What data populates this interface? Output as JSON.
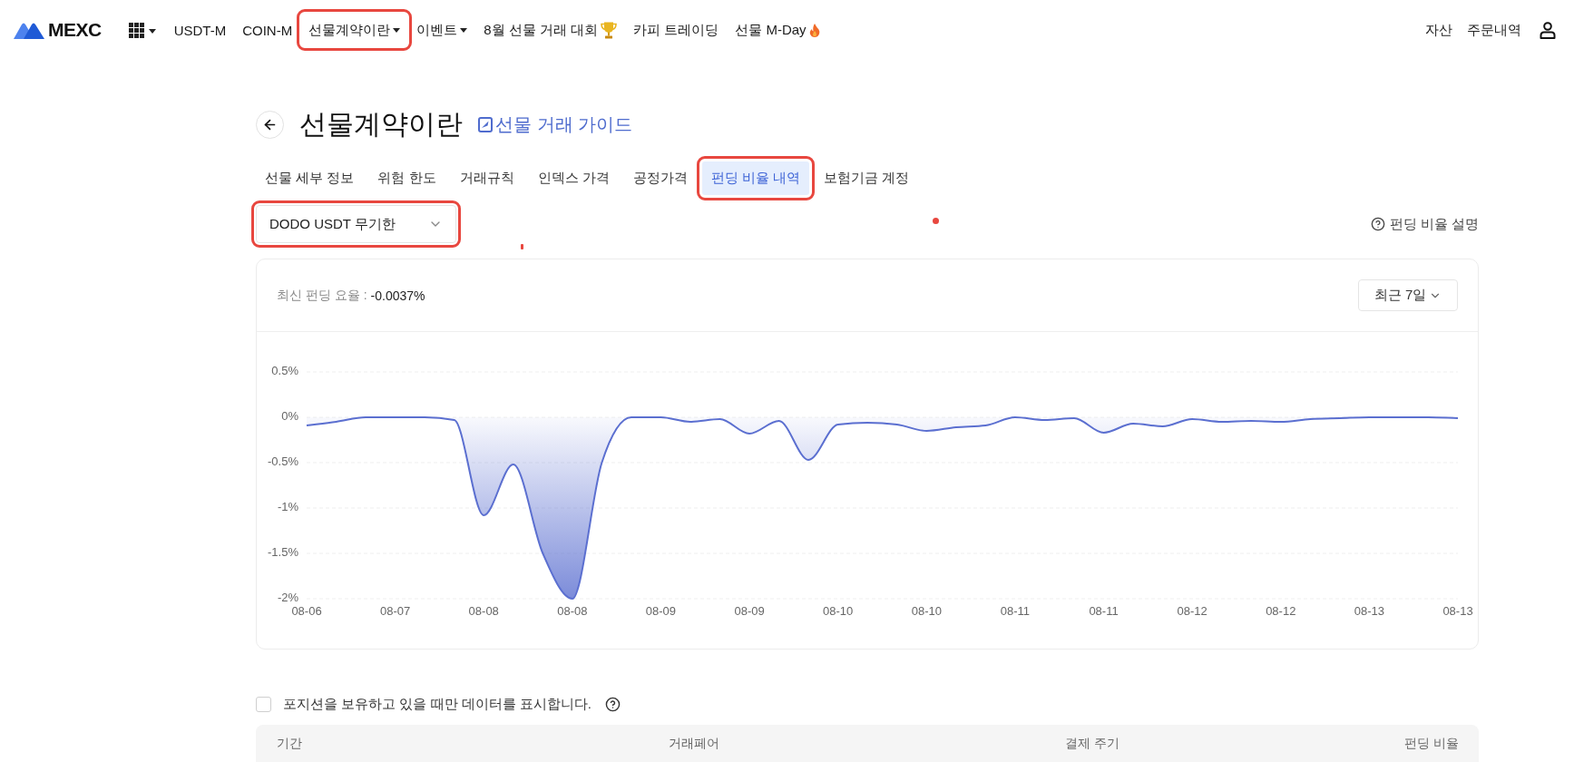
{
  "nav": {
    "logo": "MEXC",
    "items": [
      {
        "label": "USDT-M",
        "kind": "link",
        "highlighted": false
      },
      {
        "label": "COIN-M",
        "kind": "link",
        "highlighted": false
      },
      {
        "label": "선물계약이란",
        "kind": "dropdown",
        "highlighted": true
      },
      {
        "label": "이벤트",
        "kind": "dropdown",
        "highlighted": false
      },
      {
        "label": "8월 선물 거래 대회",
        "kind": "trophy",
        "highlighted": false
      },
      {
        "label": "카피 트레이딩",
        "kind": "link",
        "highlighted": false
      },
      {
        "label": "선물 M-Day",
        "kind": "fire",
        "highlighted": false
      }
    ],
    "right_items": [
      {
        "label": "자산"
      },
      {
        "label": "주문내역"
      }
    ]
  },
  "page": {
    "title": "선물계약이란",
    "guide_link": "선물 거래 가이드"
  },
  "tabs": [
    {
      "label": "선물 세부 정보",
      "selected": false,
      "highlighted": false
    },
    {
      "label": "위험 한도",
      "selected": false,
      "highlighted": false
    },
    {
      "label": "거래규칙",
      "selected": false,
      "highlighted": false
    },
    {
      "label": "인덱스 가격",
      "selected": false,
      "highlighted": false
    },
    {
      "label": "공정가격",
      "selected": false,
      "highlighted": false
    },
    {
      "label": "펀딩 비율 내역",
      "selected": true,
      "highlighted": true
    },
    {
      "label": "보험기금 계정",
      "selected": false,
      "highlighted": false
    }
  ],
  "contract_select": {
    "value": "DODO USDT 무기한",
    "highlighted": true
  },
  "help_link": "펀딩 비율 설명",
  "chart_card": {
    "latest_label": "최신 펀딩 요율 :",
    "latest_value": "-0.0037%",
    "period": "최근 7일",
    "chart_data": {
      "type": "area",
      "grid": true,
      "categories": [
        "08-06",
        null,
        null,
        "08-07",
        null,
        null,
        "08-08",
        null,
        null,
        "08-08",
        null,
        null,
        "08-09",
        null,
        null,
        "08-09",
        null,
        null,
        "08-10",
        null,
        null,
        "08-10",
        null,
        null,
        "08-11",
        null,
        null,
        "08-11",
        null,
        null,
        "08-12",
        null,
        null,
        "08-12",
        null,
        null,
        "08-13",
        null,
        null,
        "08-13"
      ],
      "series": [
        {
          "color": "#5b6fd0",
          "values": [
            -0.09,
            -0.05,
            0,
            0,
            0,
            -0.03,
            -1.08,
            -0.52,
            -1.5,
            -2.0,
            -0.5,
            0,
            0,
            -0.05,
            -0.02,
            -0.18,
            -0.04,
            -0.47,
            -0.08,
            -0.06,
            -0.08,
            -0.15,
            -0.11,
            -0.09,
            0,
            -0.03,
            -0.01,
            -0.17,
            -0.07,
            -0.1,
            -0.02,
            -0.05,
            -0.04,
            -0.05,
            -0.02,
            -0.01,
            0,
            0,
            0,
            -0.01
          ]
        }
      ],
      "ylim": [
        -2,
        0.5
      ],
      "yticks": [
        {
          "value": 0.5,
          "label": "0.5%"
        },
        {
          "value": 0,
          "label": "0%"
        },
        {
          "value": -0.5,
          "label": "-0.5%"
        },
        {
          "value": -1,
          "label": "-1%"
        },
        {
          "value": -1.5,
          "label": "-1.5%"
        },
        {
          "value": -2,
          "label": "-2%"
        }
      ]
    }
  },
  "filter": {
    "label": "포지션을 보유하고 있을 때만 데이터를 표시합니다.",
    "checked": false
  },
  "table": {
    "columns": [
      "기간",
      "거래페어",
      "결제 주기",
      "펀딩 비율"
    ]
  }
}
